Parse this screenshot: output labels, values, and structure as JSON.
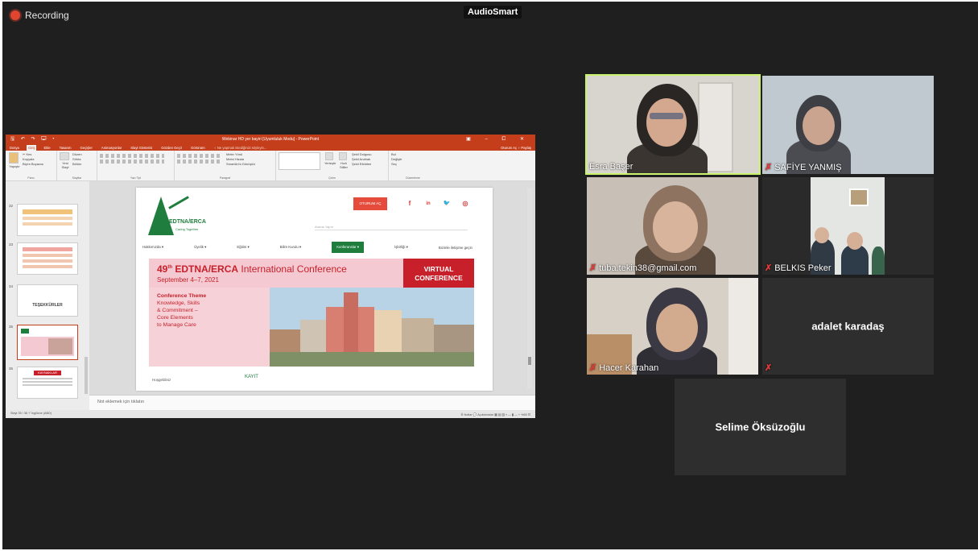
{
  "header": {
    "recording_label": "Recording",
    "brand": "AudioSmart"
  },
  "presentation": {
    "window_title": "Webinar HD yer bayiri [Uyumluluk Modu] - PowerPoint",
    "quick_access": "🖫 ↶ ↷ 🖵 ▾",
    "window_controls": "▣ – ⧠ ✕",
    "tabs": [
      "Dosya",
      "Giriş",
      "Ekle",
      "Tasarım",
      "Geçişler",
      "Animasyonlar",
      "Slayt Gösterisi",
      "Gözden Geçir",
      "Görünüm"
    ],
    "tell_me": "♀ Ne yapmak istediğinizi söyleyin...",
    "account": "Oturum Aç  ♀ Paylaş",
    "ribbon_groups": [
      "Pano",
      "Slaytlar",
      "Yazı Tipi",
      "Paragraf",
      "Çizim",
      "Düzenleme"
    ],
    "ribbon_items": {
      "paste": "Yapıştır",
      "cut": "✂ Kes",
      "copy": "Kopyala",
      "format_painter": "Biçim Boyacısı",
      "new_slide": "Yeni Slayt",
      "layout": "Düzen",
      "reset": "Sıfırla",
      "section": "Bölüm",
      "text_direction": "Metin Yönü",
      "align_text": "Metni Hizala",
      "smartart": "SmartArt'a Dönüştür",
      "arrange": "Yerleştir",
      "quick_styles": "Hızlı Stiller",
      "shape_fill": "Şekil Dolgusu",
      "shape_outline": "Şekil Anahatı",
      "shape_effects": "Şekil Efektleri",
      "find": "Bul",
      "replace": "Değiştir",
      "select": "Seç"
    },
    "thumbnails": [
      {
        "num": "32",
        "label": ""
      },
      {
        "num": "33",
        "label": ""
      },
      {
        "num": "34",
        "label": "TEŞEKKÜRLER"
      },
      {
        "num": "35",
        "label": ""
      },
      {
        "num": "36",
        "label": "KAYNAKLAR"
      }
    ],
    "notes_placeholder": "Not eklemek için tıklatın",
    "status_left": "Slayt 35 / 36   🗈   İngilizce (ABD)",
    "status_right": "≜ Notlar   💬 Açıklamalar   ▦ ▤ ▥ ▿   —  ▮  —  + %65 ⊡"
  },
  "slide": {
    "logo_name": "EDTNA/ERCA",
    "logo_tagline": "Caring Together",
    "login_button": "OTURUM AÇ",
    "social": [
      "f",
      "in",
      "🐦",
      "◎"
    ],
    "search_placeholder": "Arama Yapın",
    "nav": [
      "Hakkımızda ▾",
      "Üyelik ▾",
      "Eğitim ▾",
      "Bilim Kurulu ▾",
      "Konferanslar ▾",
      "İşbirliği ▾",
      "Bizimle iletişime geçin"
    ],
    "banner_title_sup": "th",
    "banner_title_num": "49",
    "banner_title_org": "EDTNA/ERCA",
    "banner_title_rest": "International Conference",
    "banner_date": "September 4–7, 2021",
    "banner_virtual_1": "VIRTUAL",
    "banner_virtual_2": "CONFERENCE",
    "theme_1": "Conference Theme",
    "theme_2": "Knowledge, Skills",
    "theme_3": "& Commitment –",
    "theme_4": "Core Elements",
    "theme_5": "to Manage Care",
    "register": "KAYIT",
    "welcome": "Hoşgeldiniz"
  },
  "participants": [
    {
      "name": "Esra Başer",
      "muted": false,
      "active": true,
      "video": true
    },
    {
      "name": "SAFİYE YANMIŞ",
      "muted": true,
      "active": false,
      "video": true
    },
    {
      "name": "tuba.tekin38@gmail.com",
      "muted": true,
      "active": false,
      "video": true
    },
    {
      "name": "BELKIS Peker",
      "muted": true,
      "active": false,
      "video": true
    },
    {
      "name": "Hacer Karahan",
      "muted": true,
      "active": false,
      "video": true
    },
    {
      "name": "adalet  karadaş",
      "muted": true,
      "active": false,
      "video": false
    },
    {
      "name": "Selime Öksüzoğlu",
      "muted": false,
      "active": false,
      "video": false
    }
  ],
  "icons": {
    "mic_muted": "🎙",
    "mic_muted_glyph": "⁄"
  }
}
